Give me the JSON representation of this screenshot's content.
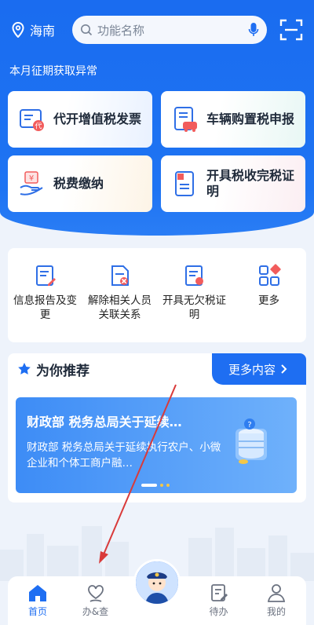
{
  "topbar": {
    "location": "海南",
    "search_placeholder": "功能名称"
  },
  "notice": "本月征期获取异常",
  "quick_cards": [
    {
      "label": "代开增值税发票"
    },
    {
      "label": "车辆购置税申报"
    },
    {
      "label": "税费缴纳"
    },
    {
      "label": "开具税收完税证明"
    }
  ],
  "services": [
    {
      "label": "信息报告及变更"
    },
    {
      "label": "解除相关人员关联关系"
    },
    {
      "label": "开具无欠税证明"
    },
    {
      "label": "更多"
    }
  ],
  "recommend": {
    "title": "为你推荐",
    "more": "更多内容",
    "banner_title": "财政部 税务总局关于延续…",
    "banner_desc": "财政部 税务总局关于延续执行农户、小微企业和个体工商户融…"
  },
  "tabs": [
    {
      "label": "首页"
    },
    {
      "label": "办&查"
    },
    {
      "label": "待办"
    },
    {
      "label": "我的"
    }
  ],
  "colors": {
    "primary": "#1e6ef2",
    "annotation_arrow": "#d93a3a"
  }
}
